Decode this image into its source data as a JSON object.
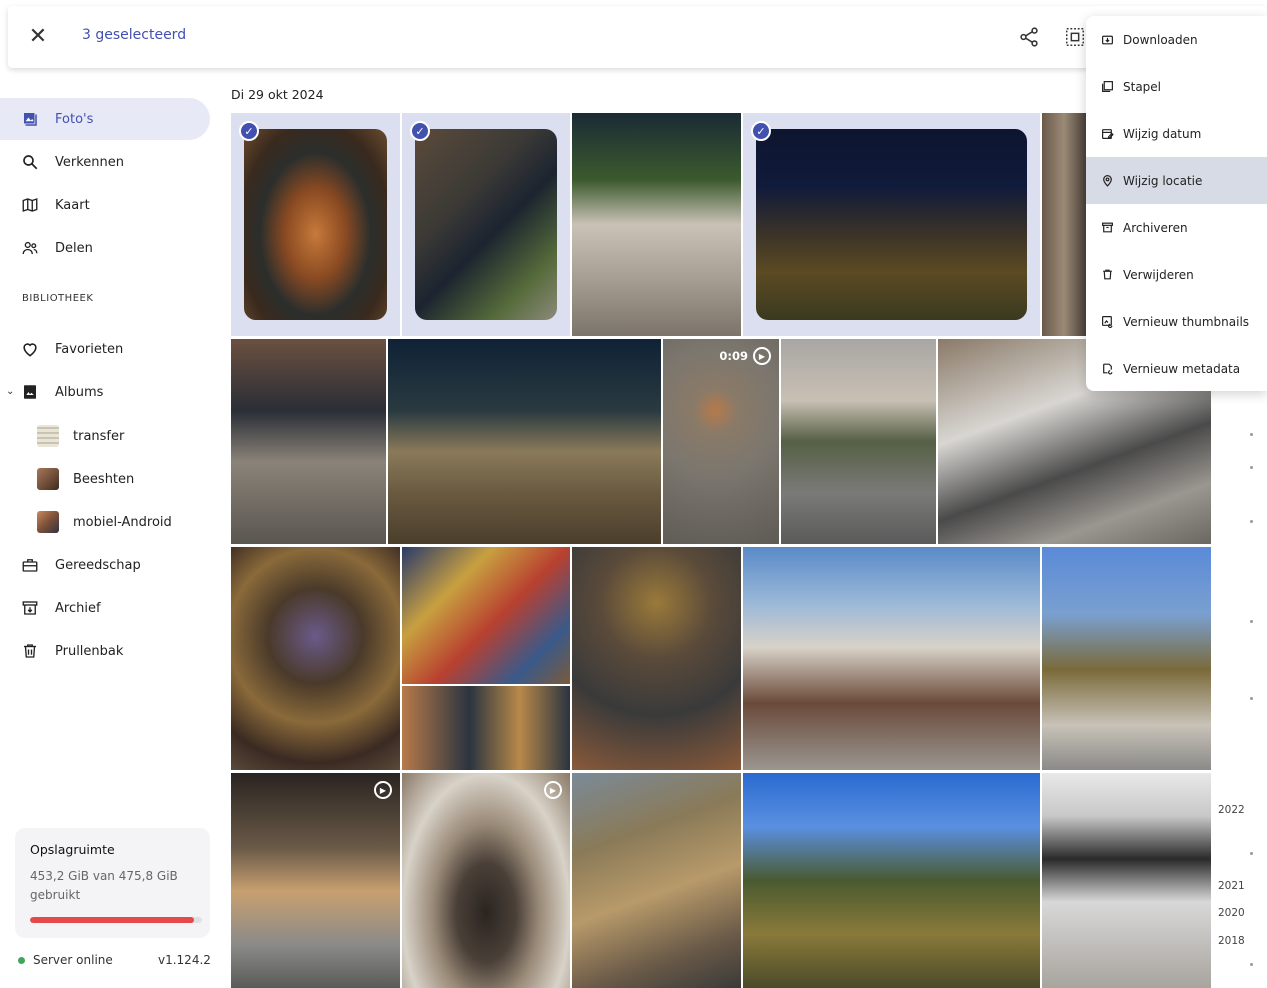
{
  "header": {
    "close_label": "✕",
    "selection_title": "3 geselecteerd"
  },
  "sidebar": {
    "items": [
      {
        "label": "Foto's",
        "icon": "photos-icon"
      },
      {
        "label": "Verkennen",
        "icon": "search-icon"
      },
      {
        "label": "Kaart",
        "icon": "map-icon"
      },
      {
        "label": "Delen",
        "icon": "people-icon"
      }
    ],
    "library_label": "BIBLIOTHEEK",
    "library": [
      {
        "label": "Favorieten",
        "icon": "heart-icon"
      },
      {
        "label": "Albums",
        "icon": "album-icon"
      }
    ],
    "albums": [
      {
        "label": "transfer"
      },
      {
        "label": "Beeshten"
      },
      {
        "label": "mobiel-Android"
      }
    ],
    "tools": [
      {
        "label": "Gereedschap",
        "icon": "toolbox-icon"
      },
      {
        "label": "Archief",
        "icon": "archive-icon"
      },
      {
        "label": "Prullenbak",
        "icon": "trash-icon"
      }
    ],
    "storage": {
      "title": "Opslagruimte",
      "text": "453,2 GiB van 475,8 GiB gebruikt",
      "used_fraction": 0.952
    },
    "server_status": "Server online",
    "version": "v1.124.2"
  },
  "main": {
    "date_header": "Di 29 okt 2024",
    "video_duration": "0:09"
  },
  "timeline": {
    "years": [
      "2022",
      "2021",
      "2020",
      "2018"
    ]
  },
  "menu": {
    "items": [
      {
        "label": "Downloaden",
        "icon": "download-icon"
      },
      {
        "label": "Stapel",
        "icon": "stack-icon"
      },
      {
        "label": "Wijzig datum",
        "icon": "calendar-edit-icon"
      },
      {
        "label": "Wijzig locatie",
        "icon": "location-icon"
      },
      {
        "label": "Archiveren",
        "icon": "archive-icon"
      },
      {
        "label": "Verwijderen",
        "icon": "trash-icon"
      },
      {
        "label": "Vernieuw thumbnails",
        "icon": "refresh-image-icon"
      },
      {
        "label": "Vernieuw metadata",
        "icon": "refresh-meta-icon"
      }
    ]
  },
  "colors": {
    "accent": "#4250af",
    "selection_bg": "#dcdff0",
    "storage_bar": "#e34a4a",
    "server_online": "#3aa95b"
  }
}
